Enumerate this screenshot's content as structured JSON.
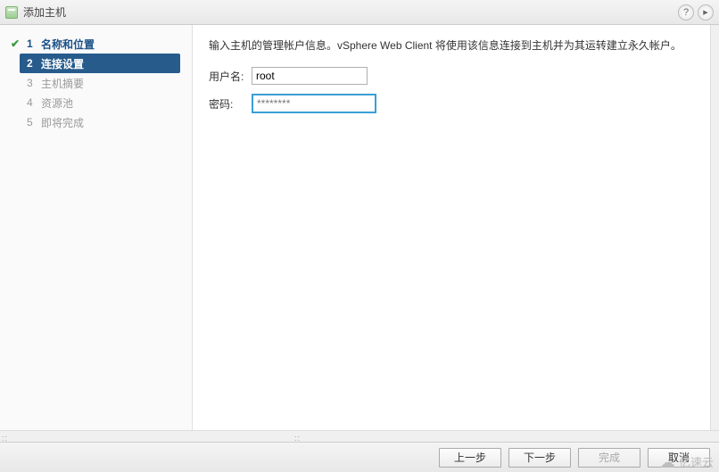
{
  "title": "添加主机",
  "steps": [
    {
      "num": "1",
      "label": "名称和位置",
      "state": "completed"
    },
    {
      "num": "2",
      "label": "连接设置",
      "state": "active"
    },
    {
      "num": "3",
      "label": "主机摘要",
      "state": "pending"
    },
    {
      "num": "4",
      "label": "资源池",
      "state": "pending"
    },
    {
      "num": "5",
      "label": "即将完成",
      "state": "pending"
    }
  ],
  "instruction": "输入主机的管理帐户信息。vSphere Web Client 将使用该信息连接到主机并为其运转建立永久帐户。",
  "form": {
    "username_label": "用户名:",
    "username_value": "root",
    "password_label": "密码:",
    "password_value": "********"
  },
  "buttons": {
    "back": "上一步",
    "next": "下一步",
    "finish": "完成",
    "cancel": "取消"
  },
  "watermark": "亿速云"
}
